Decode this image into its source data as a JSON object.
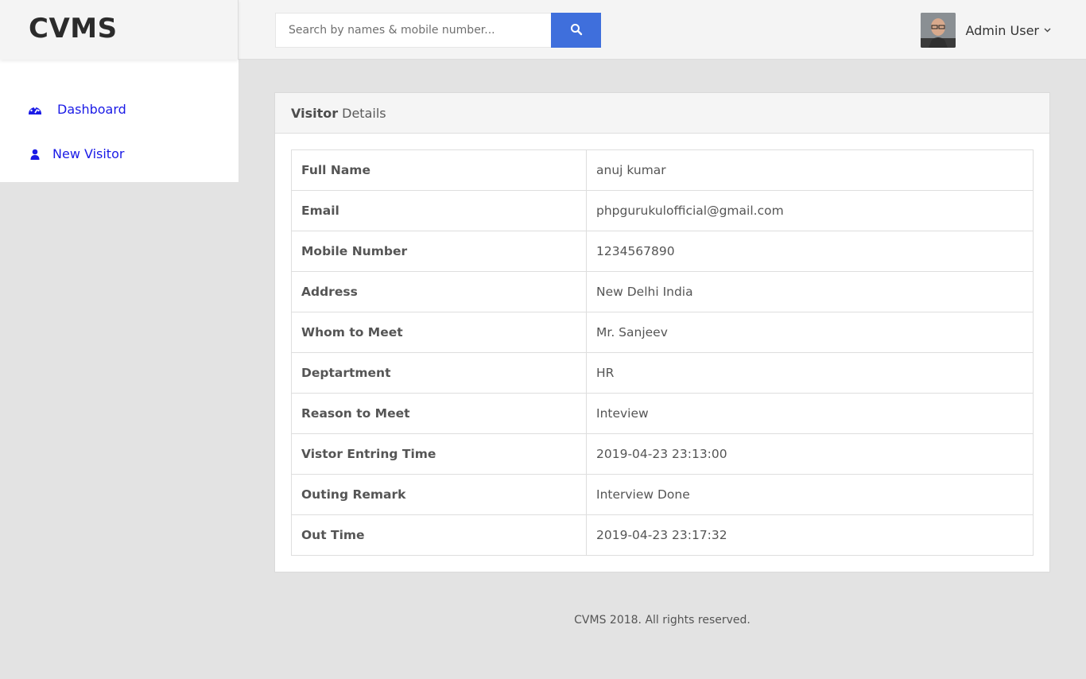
{
  "app": {
    "brand": "CVMS"
  },
  "search": {
    "placeholder": "Search by names & mobile number...",
    "button_icon": "search-icon"
  },
  "user": {
    "name": "Admin User",
    "avatar_icon": "avatar"
  },
  "sidebar": {
    "items": [
      {
        "label": "Dashboard",
        "icon": "dashboard-gauge-icon"
      },
      {
        "label": "New Visitor",
        "icon": "user-icon"
      }
    ]
  },
  "card": {
    "title_bold": "Visitor",
    "title_rest": "Details",
    "rows": [
      {
        "label": "Full Name",
        "value": "anuj kumar"
      },
      {
        "label": "Email",
        "value": "phpgurukulofficial@gmail.com"
      },
      {
        "label": "Mobile Number",
        "value": "1234567890"
      },
      {
        "label": "Address",
        "value": "New Delhi India"
      },
      {
        "label": "Whom to Meet",
        "value": "Mr. Sanjeev"
      },
      {
        "label": "Deptartment",
        "value": "HR"
      },
      {
        "label": "Reason to Meet",
        "value": "Inteview"
      },
      {
        "label": "Vistor Entring Time",
        "value": "2019-04-23 23:13:00"
      },
      {
        "label": "Outing Remark",
        "value": "Interview Done"
      },
      {
        "label": "Out Time",
        "value": "2019-04-23 23:17:32"
      }
    ]
  },
  "footer": {
    "text": "CVMS 2018. All rights reserved."
  },
  "colors": {
    "accent": "#3f6fdc",
    "nav_link": "#1a1ae6",
    "background": "#e3e3e3"
  }
}
